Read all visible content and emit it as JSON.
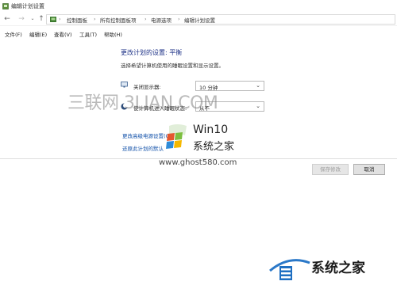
{
  "window": {
    "title": "编辑计划设置"
  },
  "address": {
    "crumbs": [
      "控制面板",
      "所有控制面板项",
      "电源选项",
      "编辑计划设置"
    ],
    "separator": "›"
  },
  "nav": {
    "back": "←",
    "forward": "→",
    "recent": "⌄",
    "up": "↑"
  },
  "menu": [
    "文件(F)",
    "编辑(E)",
    "查看(V)",
    "工具(T)",
    "帮助(H)"
  ],
  "content": {
    "heading": "更改计划的设置: 平衡",
    "subheading": "选择希望计算机使用的睡眠设置和显示设置。",
    "settings": [
      {
        "label": "关闭显示器:",
        "value": "10 分钟",
        "icon": "monitor-icon"
      },
      {
        "label": "使计算机进入睡眠状态:",
        "value": "从不",
        "icon": "moon-icon"
      }
    ],
    "links": {
      "advanced": "更改高级电源设置(C)",
      "restore": "还原此计划的默认"
    }
  },
  "buttons": {
    "save": "保存修改",
    "cancel": "取消"
  },
  "watermarks": {
    "site1": "三联网 3LIAN.COM",
    "win10": "Win10",
    "xitong": "系统之家",
    "url": "www.ghost580.com",
    "brand": "系统之家"
  },
  "colors": {
    "heading": "#1e3287",
    "link": "#0f4fa8"
  }
}
